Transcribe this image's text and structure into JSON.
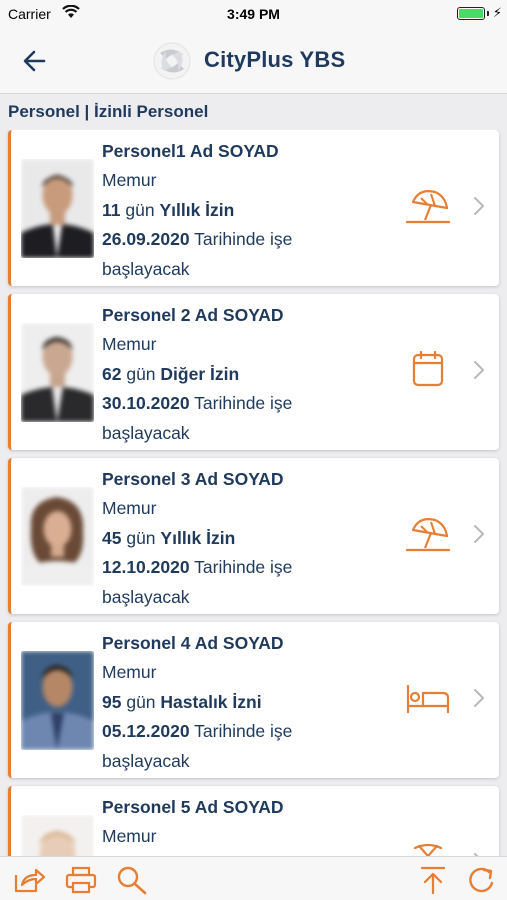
{
  "status": {
    "carrier": "Carrier",
    "time": "3:49 PM"
  },
  "nav": {
    "title": "CityPlus YBS"
  },
  "breadcrumb": "Personel | İzinli Personel",
  "cards": [
    {
      "name": "Personel1 Ad SOYAD",
      "role": "Memur",
      "days": "11",
      "days_unit": "gün",
      "leave_type": "Yıllık İzin",
      "date": "26.09.2020",
      "date_suffix": "Tarihinde işe",
      "starts": "başlayacak",
      "icon": "beach-umbrella-icon"
    },
    {
      "name": "Personel 2 Ad SOYAD",
      "role": "Memur",
      "days": "62",
      "days_unit": "gün",
      "leave_type": "Diğer İzin",
      "date": "30.10.2020",
      "date_suffix": "Tarihinde işe",
      "starts": "başlayacak",
      "icon": "calendar-icon"
    },
    {
      "name": "Personel 3 Ad SOYAD",
      "role": "Memur",
      "days": "45",
      "days_unit": "gün",
      "leave_type": "Yıllık İzin",
      "date": "12.10.2020",
      "date_suffix": "Tarihinde işe",
      "starts": "başlayacak",
      "icon": "beach-umbrella-icon"
    },
    {
      "name": "Personel 4 Ad SOYAD",
      "role": "Memur",
      "days": "95",
      "days_unit": "gün",
      "leave_type": "Hastalık İzni",
      "date": "05.12.2020",
      "date_suffix": "Tarihinde işe",
      "starts": "başlayacak",
      "icon": "bed-icon"
    },
    {
      "name": "Personel 5 Ad SOYAD",
      "role": "Memur",
      "days": "",
      "days_unit": "",
      "leave_type": "",
      "date": "",
      "date_suffix": "",
      "starts": "",
      "icon": "baby-icon"
    }
  ],
  "toolbar": {
    "icons": [
      "share-icon",
      "print-icon",
      "search-icon",
      "scroll-top-icon",
      "refresh-icon"
    ]
  },
  "colors": {
    "accent": "#e67e33",
    "text": "#1f3a5c",
    "background": "#ededef"
  }
}
